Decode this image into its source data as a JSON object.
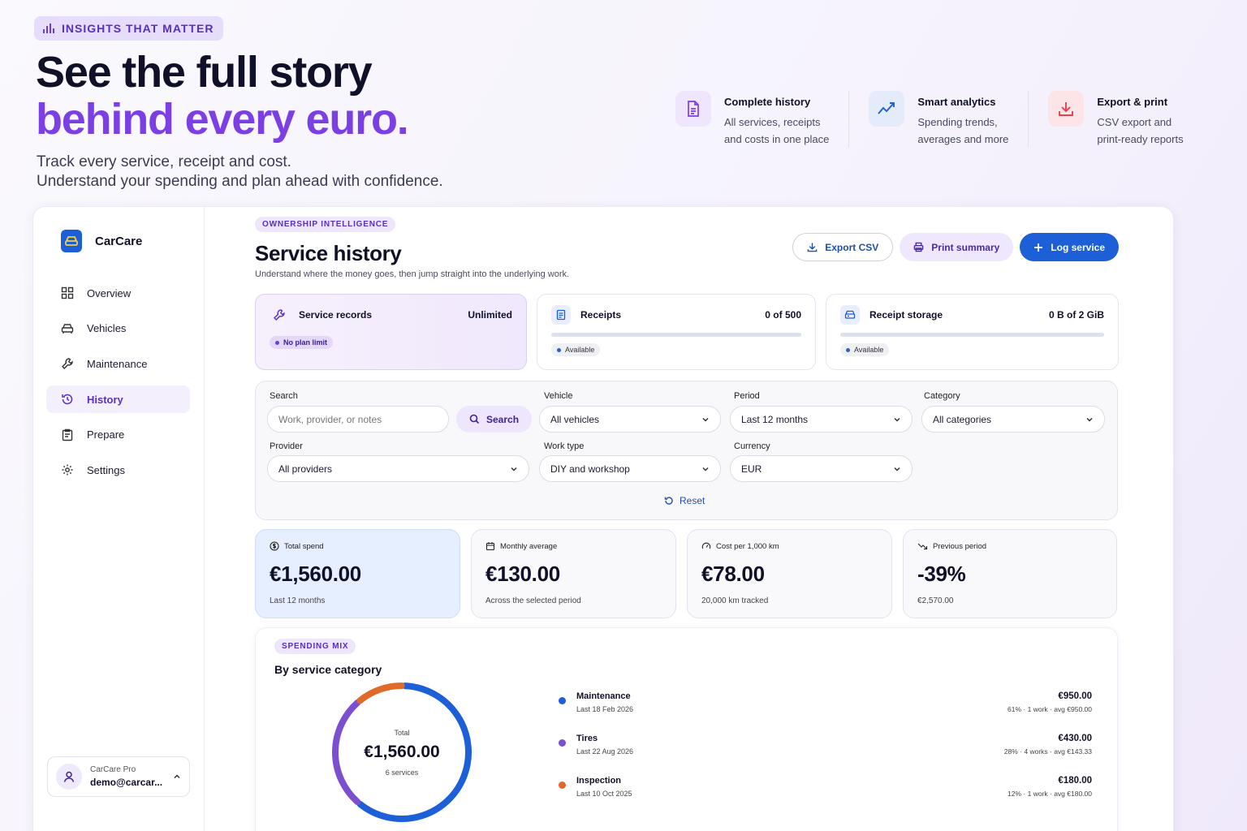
{
  "hero": {
    "eyebrow": "INSIGHTS THAT MATTER",
    "title_line1": "See the full story",
    "title_line2": "behind every euro.",
    "subtitle_line1": "Track every service, receipt and cost.",
    "subtitle_line2": "Understand your spending and plan ahead with confidence."
  },
  "features": [
    {
      "title": "Complete history",
      "line1": "All services, receipts",
      "line2": "and costs in one place",
      "icon": "document-icon",
      "color": "#7b3fe4"
    },
    {
      "title": "Smart analytics",
      "line1": "Spending trends,",
      "line2": "averages and more",
      "icon": "trend-chart-icon",
      "color": "#1d5fd6"
    },
    {
      "title": "Export & print",
      "line1": "CSV export and",
      "line2": "print-ready reports",
      "icon": "download-icon",
      "color": "#e0424f"
    }
  ],
  "sidebar": {
    "brand": "CarCare",
    "items": [
      {
        "label": "Overview",
        "icon": "grid-icon"
      },
      {
        "label": "Vehicles",
        "icon": "car-icon"
      },
      {
        "label": "Maintenance",
        "icon": "wrench-icon"
      },
      {
        "label": "History",
        "icon": "history-icon",
        "active": true
      },
      {
        "label": "Prepare",
        "icon": "clipboard-icon"
      },
      {
        "label": "Settings",
        "icon": "gear-icon"
      }
    ],
    "account": {
      "plan": "CarCare Pro",
      "email": "demo@carcar..."
    }
  },
  "page": {
    "pill": "OWNERSHIP INTELLIGENCE",
    "title": "Service history",
    "description": "Understand where the money goes, then jump straight into the underlying work.",
    "actions": {
      "export": "Export CSV",
      "print": "Print summary",
      "log": "Log service"
    }
  },
  "quotas": [
    {
      "label": "Service records",
      "value": "Unlimited",
      "badge": "No plan limit"
    },
    {
      "label": "Receipts",
      "value": "0 of 500",
      "badge": "Available",
      "progress": 0
    },
    {
      "label": "Receipt storage",
      "value": "0 B of 2 GiB",
      "badge": "Available",
      "progress": 0
    }
  ],
  "filters": {
    "search_label": "Search",
    "search_placeholder": "Work, provider, or notes",
    "search_button": "Search",
    "vehicle_label": "Vehicle",
    "vehicle_value": "All vehicles",
    "period_label": "Period",
    "period_value": "Last 12 months",
    "category_label": "Category",
    "category_value": "All categories",
    "provider_label": "Provider",
    "provider_value": "All providers",
    "worktype_label": "Work type",
    "worktype_value": "DIY and workshop",
    "currency_label": "Currency",
    "currency_value": "EUR",
    "reset": "Reset"
  },
  "stats": [
    {
      "label": "Total spend",
      "value": "€1,560.00",
      "sub": "Last 12 months",
      "icon": "dollar-circle-icon"
    },
    {
      "label": "Monthly average",
      "value": "€130.00",
      "sub": "Across the selected period",
      "icon": "calendar-icon"
    },
    {
      "label": "Cost per 1,000 km",
      "value": "€78.00",
      "sub": "20,000 km tracked",
      "icon": "gauge-icon"
    },
    {
      "label": "Previous period",
      "value": "-39%",
      "sub": "€2,570.00",
      "icon": "trend-down-icon"
    }
  ],
  "mix": {
    "pill": "SPENDING MIX",
    "title": "By service category",
    "center_label": "Total",
    "center_value": "€1,560.00",
    "center_sub": "6 services",
    "categories": [
      {
        "name": "Maintenance",
        "last": "Last 18 Feb 2026",
        "amount": "€950.00",
        "meta": "61% · 1 work · avg €950.00",
        "color": "#1d5fd6",
        "value": 950
      },
      {
        "name": "Tires",
        "last": "Last 22 Aug 2026",
        "amount": "€430.00",
        "meta": "28% · 4 works · avg €143.33",
        "color": "#7b4fd0",
        "value": 430
      },
      {
        "name": "Inspection",
        "last": "Last 10 Oct 2025",
        "amount": "€180.00",
        "meta": "12% · 1 work · avg €180.00",
        "color": "#e06a2a",
        "value": 180
      }
    ]
  }
}
